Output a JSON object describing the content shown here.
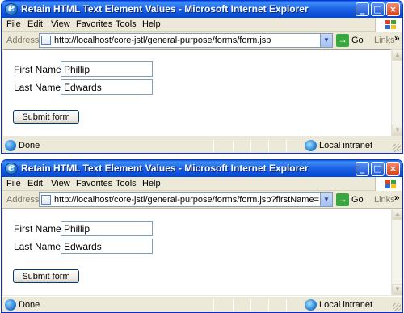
{
  "windows": [
    {
      "title": "Retain HTML Text Element Values - Microsoft Internet Explorer",
      "menu": [
        "File",
        "Edit",
        "View",
        "Favorites",
        "Tools",
        "Help"
      ],
      "address_label": "Address",
      "address_url": "http://localhost/core-jstl/general-purpose/forms/form.jsp",
      "go_label": "Go",
      "links_label": "Links",
      "first_name_label": "First Name:",
      "first_name_value": "Phillip",
      "last_name_label": "Last Name:",
      "last_name_value": "Edwards",
      "submit_label": "Submit form",
      "status_text": "Done",
      "zone_text": "Local intranet"
    },
    {
      "title": "Retain HTML Text Element Values - Microsoft Internet Explorer",
      "menu": [
        "File",
        "Edit",
        "View",
        "Favorites",
        "Tools",
        "Help"
      ],
      "address_label": "Address",
      "address_url": "http://localhost/core-jstl/general-purpose/forms/form.jsp?firstName=Phillip&lastName=",
      "go_label": "Go",
      "links_label": "Links",
      "first_name_label": "First Name:",
      "first_name_value": "Phillip",
      "last_name_label": "Last Name:",
      "last_name_value": "Edwards",
      "submit_label": "Submit form",
      "status_text": "Done",
      "zone_text": "Local intranet"
    }
  ],
  "icons": {
    "app": "ie-icon",
    "minimize": "minimize-icon",
    "maximize": "maximize-icon",
    "close": "close-icon",
    "page": "page-icon",
    "go": "go-arrow-icon",
    "zone": "globe-icon"
  },
  "colors": {
    "titlebar": "#0b4fd8",
    "chrome": "#ece9d8",
    "go_green": "#3aa640"
  }
}
